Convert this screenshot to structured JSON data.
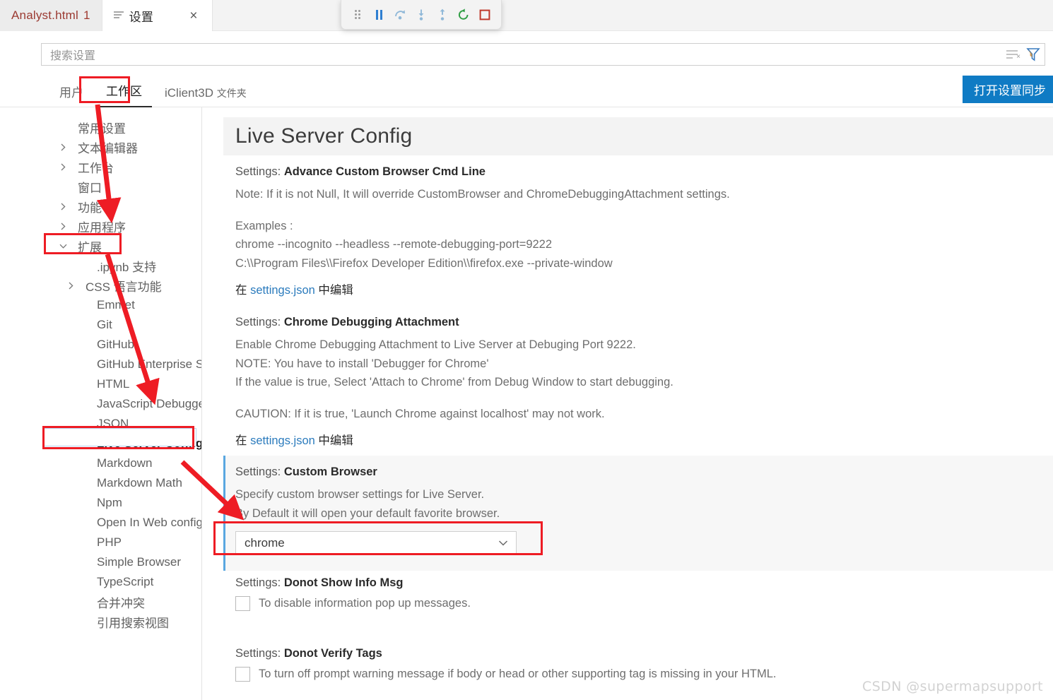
{
  "editor_tabs": [
    {
      "label": "Analyst.html",
      "badge": "1",
      "icon": "",
      "active": false
    },
    {
      "label": "设置",
      "badge": "",
      "icon": "settings-lines-icon",
      "active": true,
      "close": "×"
    }
  ],
  "debug_toolbar": {
    "buttons": [
      {
        "name": "drag-handle-icon",
        "title": ""
      },
      {
        "name": "pause-icon",
        "title": ""
      },
      {
        "name": "step-over-icon",
        "title": ""
      },
      {
        "name": "step-into-icon",
        "title": ""
      },
      {
        "name": "step-out-icon",
        "title": ""
      },
      {
        "name": "restart-icon",
        "title": ""
      },
      {
        "name": "stop-icon",
        "title": ""
      }
    ],
    "colors": {
      "pause": "#2f7fd1",
      "step": "#8fb8d8",
      "restart": "#2f9e44",
      "stop": "#c0392b"
    }
  },
  "search": {
    "placeholder": "搜索设置",
    "value": "",
    "clear_filters_icon": "clear-filters-icon",
    "filter_icon": "filter-funnel-icon"
  },
  "settings_tabs": [
    {
      "label": "用户",
      "sub": "",
      "active": false
    },
    {
      "label": "工作区",
      "sub": "",
      "active": true
    },
    {
      "label": "iClient3D",
      "sub": "文件夹",
      "active": false
    }
  ],
  "sync_button": {
    "label": "打开设置同步",
    "color": "#0f7bc4"
  },
  "toc": [
    {
      "label": "常用设置",
      "level": 0,
      "chevron": "",
      "selected": false
    },
    {
      "label": "文本编辑器",
      "level": 0,
      "chevron": "right",
      "selected": false
    },
    {
      "label": "工作台",
      "level": 0,
      "chevron": "right",
      "selected": false
    },
    {
      "label": "窗口",
      "level": 0,
      "chevron": "",
      "selected": false
    },
    {
      "label": "功能",
      "level": 0,
      "chevron": "right",
      "selected": false
    },
    {
      "label": "应用程序",
      "level": 0,
      "chevron": "right",
      "selected": false
    },
    {
      "label": "扩展",
      "level": 0,
      "chevron": "down",
      "selected": false
    },
    {
      "label": ".ipynb 支持",
      "level": 1,
      "chevron": "",
      "selected": false
    },
    {
      "label": "CSS 语言功能",
      "level": 1,
      "chevron": "right",
      "selected": false
    },
    {
      "label": "Emmet",
      "level": 1,
      "chevron": "",
      "selected": false
    },
    {
      "label": "Git",
      "level": 1,
      "chevron": "",
      "selected": false
    },
    {
      "label": "GitHub",
      "level": 1,
      "chevron": "",
      "selected": false
    },
    {
      "label": "GitHub Enterprise Ser...",
      "level": 1,
      "chevron": "",
      "selected": false
    },
    {
      "label": "HTML",
      "level": 1,
      "chevron": "",
      "selected": false
    },
    {
      "label": "JavaScript Debugger",
      "level": 1,
      "chevron": "",
      "selected": false
    },
    {
      "label": "JSON",
      "level": 1,
      "chevron": "",
      "selected": false
    },
    {
      "label": "Live Server Config",
      "level": 1,
      "chevron": "",
      "selected": true
    },
    {
      "label": "Markdown",
      "level": 1,
      "chevron": "",
      "selected": false
    },
    {
      "label": "Markdown Math",
      "level": 1,
      "chevron": "",
      "selected": false
    },
    {
      "label": "Npm",
      "level": 1,
      "chevron": "",
      "selected": false
    },
    {
      "label": "Open In Web configur...",
      "level": 1,
      "chevron": "",
      "selected": false
    },
    {
      "label": "PHP",
      "level": 1,
      "chevron": "",
      "selected": false
    },
    {
      "label": "Simple Browser",
      "level": 1,
      "chevron": "",
      "selected": false
    },
    {
      "label": "TypeScript",
      "level": 1,
      "chevron": "",
      "selected": false
    },
    {
      "label": "合并冲突",
      "level": 1,
      "chevron": "",
      "selected": false
    },
    {
      "label": "引用搜索视图",
      "level": 1,
      "chevron": "",
      "selected": false
    }
  ],
  "main": {
    "header": "Live Server Config",
    "settings": [
      {
        "prefix": "Settings:",
        "name": "Advance Custom Browser Cmd Line",
        "lines": [
          "Note: If it is not Null, It will override CustomBrowser and ChromeDebuggingAttachment settings.",
          "",
          "Examples :",
          "chrome --incognito --headless --remote-debugging-port=9222",
          "C:\\\\Program Files\\\\Firefox Developer Edition\\\\firefox.exe --private-window"
        ],
        "link_prefix": "在",
        "link_text": "settings.json",
        "link_suffix": "中编辑"
      },
      {
        "prefix": "Settings:",
        "name": "Chrome Debugging Attachment",
        "lines": [
          "Enable Chrome Debugging Attachment to Live Server at Debuging Port 9222.",
          "NOTE: You have to install 'Debugger for Chrome'",
          "If the value is true, Select 'Attach to Chrome' from Debug Window to start debugging.",
          "",
          "CAUTION: If it is true, 'Launch Chrome against localhost' may not work."
        ],
        "link_prefix": "在",
        "link_text": "settings.json",
        "link_suffix": "中编辑"
      },
      {
        "prefix": "Settings:",
        "name": "Custom Browser",
        "lines": [
          "Specify custom browser settings for Live Server.",
          "By Default it will open your default favorite browser."
        ],
        "dropdown_value": "chrome",
        "modified_accent": "#5aa7e0"
      },
      {
        "prefix": "Settings:",
        "name": "Donot Show Info Msg",
        "checkbox_label": "To disable information pop up messages.",
        "checked": false
      },
      {
        "prefix": "Settings:",
        "name": "Donot Verify Tags",
        "checkbox_label": "To turn off prompt warning message if body or head or other supporting tag is missing in your HTML.",
        "checked": false
      }
    ]
  },
  "annotations": {
    "color": "#ee1c24",
    "boxes": [
      {
        "name": "workspace-tab-highlight"
      },
      {
        "name": "extensions-node-highlight"
      },
      {
        "name": "live-server-config-highlight"
      },
      {
        "name": "custom-browser-dropdown-highlight"
      }
    ],
    "arrows": [
      {
        "name": "arrow-to-extensions"
      },
      {
        "name": "arrow-to-live-server-config"
      },
      {
        "name": "arrow-to-custom-browser"
      }
    ]
  },
  "watermark": "CSDN @supermapsupport"
}
